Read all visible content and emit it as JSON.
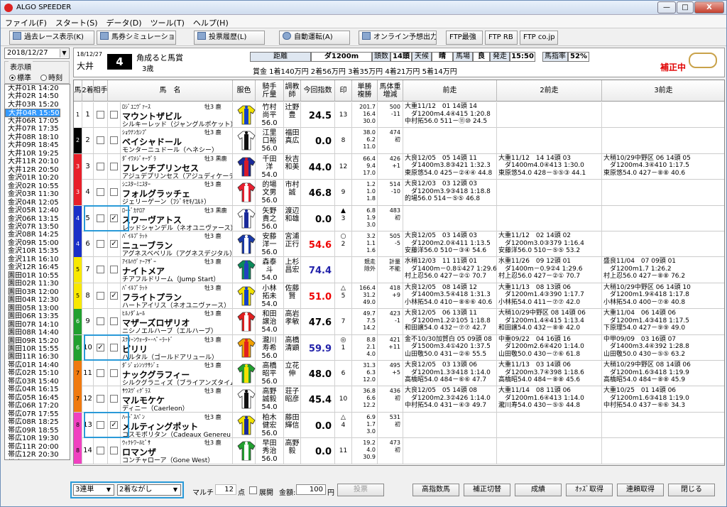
{
  "window": {
    "title": "ALGO SPEEDER",
    "min": "—",
    "max": "□",
    "close": "X"
  },
  "menu": [
    "ファイル(F)",
    "スタート(S)",
    "データ(D)",
    "ツール(T)",
    "ヘルプ(H)"
  ],
  "toolbar": [
    "過去レース表示(K)",
    "馬券シミュレーション(B)",
    "投票履歴(L)",
    "自動運転(A)",
    "オンライン予想出力",
    "FTP最強",
    "FTP RB",
    "FTP co.jp"
  ],
  "side": {
    "date": "2018/12/27",
    "order_label": "表示順",
    "opt1": "標準",
    "opt2": "時刻",
    "races": [
      "大井01R 14:20",
      "大井02R 14:50",
      "大井03R 15:20",
      "大井04R 15:50",
      "大井05R 16:30",
      "大井06R 17:05",
      "大井07R 17:35",
      "大井08R 18:10",
      "大井09R 18:45",
      "大井10R 19:25",
      "大井11R 20:10",
      "大井12R 20:50",
      "金沢01R 10:20",
      "金沢02R 10:55",
      "金沢03R 11:30",
      "金沢04R 12:05",
      "金沢05R 12:40",
      "金沢06R 13:15",
      "金沢07R 13:50",
      "金沢08R 14:25",
      "金沢09R 15:00",
      "金沢10R 15:35",
      "金沢11R 16:10",
      "金沢12R 16:45",
      "園田01R 10:55",
      "園田02R 11:30",
      "園田03R 12:00",
      "園田04R 12:30",
      "園田05R 13:00",
      "園田06R 13:35",
      "園田07R 14:10",
      "園田08R 14:40",
      "園田09R 15:20",
      "園田10R 15:55",
      "園田11R 16:30",
      "帯広01R 14:40",
      "帯広02R 15:10",
      "帯広03R 15:40",
      "帯広04R 16:15",
      "帯広05R 16:45",
      "帯広06R 17:20",
      "帯広07R 17:55",
      "帯広08R 18:25",
      "帯広09R 18:55",
      "帯広10R 19:30",
      "帯広11R 20:00",
      "帯広12R 20:30",
      "帯広13R 21:00"
    ],
    "selected": 3
  },
  "race": {
    "date": "18/12/27",
    "venue": "大井",
    "num": "4",
    "name": "角成ると馬賞",
    "age": "3歳",
    "labels": [
      "距離",
      "頭数",
      "天候",
      "馬場",
      "発走",
      "馬指率"
    ],
    "values": [
      "ダ1200m",
      "14頭",
      "晴",
      "良",
      "15:50",
      "52%"
    ],
    "prize": "賞金 1着140万円  2着56万円  3着35万円  4着21万円  5着14万円",
    "hosei": "補正中"
  },
  "headers": [
    "馬",
    "2着",
    "相手",
    "馬　名",
    "服色",
    "騎手\n斤量",
    "調教\n師",
    "今回指数",
    "印",
    "単勝\n複勝",
    "馬体重\n増減",
    "前走",
    "2前走",
    "3前走"
  ],
  "horses": [
    {
      "waku": "1",
      "wc": "#ffffff",
      "n": "1",
      "c2": false,
      "c3": false,
      "sire": "ﾛｼﾞﾕﾆｳﾞｧｰｽ",
      "name": "マウントザビル",
      "dam": "シルキーレッド（ジャングルポケット）",
      "sex": "牡3 鹿",
      "jk": "竹村\n尚平\n56.0",
      "tr": "辻野\n豊",
      "idx": "24.5",
      "ic": "#000",
      "mk": "\n13",
      "od": "201.7\n16.4\n30.0",
      "pw": "500\n-11",
      "p1": "大重11/12　01 14頭 14\n　ダ1200m4.4④415 1:20.8\n中村拓56.0 511－⑪⑩ 24.5",
      "p2": "",
      "p3": "",
      "silk": [
        "#f2e200",
        "#1540c8"
      ]
    },
    {
      "waku": "2",
      "wc": "#000000",
      "n": "2",
      "c2": false,
      "c3": false,
      "sire": "ｼｮｳﾅﾝｶﾝﾌﾟ",
      "name": "ベイシャドール",
      "dam": "モンターニュドール（ヘネシー）",
      "sex": "牡3 鹿",
      "jk": "江里\n口裕\n56.0",
      "tr": "福田\n真広",
      "idx": "0.0",
      "ic": "#000",
      "mk": "\n8",
      "od": "38.0\n6.2\n11.0",
      "pw": "474\n初",
      "p1": "",
      "p2": "",
      "p3": "",
      "silk": [
        "#ffffff",
        "#111111"
      ]
    },
    {
      "waku": "3",
      "wc": "#e8202a",
      "n": "3",
      "c2": false,
      "c3": false,
      "sire": "ﾀﾞｲﾜﾒｼﾞｬｰｸﾞﾗ",
      "name": "フレンチプリンセス",
      "dam": "アジュデプリンセス（アジュディケーティ",
      "sex": "牡3 黒鹿",
      "jk": "千田\n洋\n54.0",
      "tr": "秋吉\n和美",
      "idx": "44.0",
      "ic": "#000",
      "mk": "\n12",
      "od": "66.4\n9.4\n17.0",
      "pw": "426\n+1",
      "p1": "大良12/05　05 14頭 11\n　ダ1400m3.8③421 1:32.3\n東原悠54.0 425－②④④ 44.8",
      "p2": "大重11/12　14 14頭 03\n　ダ1400m4.0④413 1:30.0\n東原悠54.0 428－⑤⑤③ 44.1",
      "p3": "大稍10/29中野区 06 14頭 05\n　ダ1200m4.3④410 1:17.5\n東原悠54.0 427－⑧⑧ 40.6",
      "silk": [
        "#1a2a9a",
        "#d81a2a"
      ]
    },
    {
      "waku": "3",
      "wc": "#e8202a",
      "n": "4",
      "c2": false,
      "c3": false,
      "sire": "ｼﾆｽﾀｰﾐﾆｽﾀｰ",
      "name": "フォルグラッチェ",
      "dam": "ジェリーゲーン（ﾌｼﾞｷｾｷ/ｺﾙﾄ）",
      "sex": "牡3 鹿",
      "jk": "的場\n文男\n56.0",
      "tr": "市村\n誠",
      "idx": "46.8",
      "ic": "#000",
      "mk": "\n9",
      "od": "1.2\n1.0\n1.8",
      "pw": "514\n-10",
      "p1": "大良12/03　03 12頭 03\n　ダ1200m3.9③418 1:18.8\n的場56.0 514－⑤⑤ 46.8",
      "p2": "",
      "p3": "",
      "silk": [
        "#e82030",
        "#ffffff"
      ]
    },
    {
      "waku": "4",
      "wc": "#1a30c8",
      "n": "5",
      "c2": true,
      "c3": true,
      "v2": "",
      "v3": "✓",
      "sire": "ﾛｰﾄﾞｶﾅﾛｱ",
      "name": "スワーヴアトス",
      "dam": "レッドシャンデル（ネオユニヴァース）",
      "sex": "牡3 黒鹿",
      "jk": "矢野\n貴之\n56.0",
      "tr": "渡辺\n和雄",
      "idx": "0.0",
      "ic": "#000",
      "mk": "▲\n3",
      "od": "6.8\n1.9\n3.0",
      "pw": "483\n初",
      "p1": "",
      "p2": "",
      "p3": "",
      "silk": [
        "#ffffff",
        "#1a2a9a"
      ]
    },
    {
      "waku": "4",
      "wc": "#1a30c8",
      "n": "6",
      "c2": false,
      "c3": true,
      "v3": "✓",
      "sire": "ﾊﾟｲﾙﾌﾟﾗｯﾄ",
      "name": "ニューブラン",
      "dam": "アグネスベベリル（アグネスデジタル）",
      "sex": "牡3 鹿",
      "jk": "安藤\n洋一\n56.0",
      "tr": "宮浦\n正行",
      "idx": "54.6",
      "ic": "#e00",
      "mk": "○\n2",
      "od": "3.2\n1.1\n1.6",
      "pw": "505\n-5",
      "p1": "大良12/05　03 14頭 03\n　ダ1200m2.0④411 1:13.5\n安藤洋56.0 510－③④ 54.6",
      "p2": "大重11/12　02 14頭 02\n　ダ1200m3.0③379 1:16.4\n安藤洋56.0 510－⑤⑤ 53.2",
      "p3": "",
      "silk": [
        "#1a3aa8",
        "#ffffff"
      ]
    },
    {
      "waku": "5",
      "wc": "#f8e800",
      "n": "7",
      "c2": false,
      "c3": false,
      "sire": "ｱｲﾙﾊｳﾞｧｰｱｻﾞｰ",
      "name": "ナイトメア",
      "dam": "チアフルドリーム（Jump Start）",
      "sex": "牡3 鹿",
      "jk": "森泰\n斗\n54.0",
      "tr": "上杉\n昌宏",
      "idx": "74.4",
      "ic": "#22a",
      "mk": "",
      "od": "競走\n除外",
      "pw": "計量\n不能",
      "p1": "水稍12/03　11 11頭 01\n　ダ1400m－0.8①427 1:29.6\n村上忍56.0 427－②① 70.7",
      "p2": "水重11/26　09 12頭 01\n　ダ1400m－0.9②4 1:29.6\n村上忍56.0 427－②① 70.7",
      "p3": "盛良11/04　07 09頭 01\n　ダ1200m1.7 1:26.2\n村上忍56.0 427－⑧⑧ 76.2",
      "silk": [
        "#0a8a5a",
        "#2040c0"
      ]
    },
    {
      "waku": "5",
      "wc": "#f8e800",
      "n": "8",
      "c2": false,
      "c3": true,
      "v3": "✓",
      "sire": "ﾊﾟｲﾙﾌﾟﾗｯﾄ",
      "name": "フライトプラン",
      "dam": "ハートアイリス（ネオユニヴァース）",
      "sex": "牡3 鹿",
      "jk": "小林\n拓未\n54.0",
      "tr": "佐藤\n賢",
      "idx": "51.0",
      "ic": "#e00",
      "mk": "△\n5",
      "od": "166.4\n31.2\n49.0",
      "pw": "418\n+9",
      "p1": "大良12/05　08 14頭 12\n　ダ1400m3.5④418 1:31.3\n小林拓54.0 410－⑧⑥⑥ 40.6",
      "p2": "大重11/13　08 13頭 06\n　ダ1200m1.4③390 1:17.7\n小林拓54.0 411－⑦⑦ 42.0",
      "p3": "大稍10/29中野区 06 14頭 10\n　ダ1200m1.9④418 1:17.8\n小林拓54.0 400－⑦⑧ 40.8",
      "silk": [
        "#f2e200",
        "#1540c8"
      ]
    },
    {
      "waku": "6",
      "wc": "#22a030",
      "n": "9",
      "c2": false,
      "c3": false,
      "sire": "ﾋﾙﾉﾀﾞﾑｰﾙ",
      "name": "マザーズロザリオ",
      "dam": "ニシノエルハーブ（エルハーブ）",
      "sex": "牡3 鹿",
      "jk": "和田\n譲治\n54.0",
      "tr": "高岩\n孝敏",
      "idx": "47.6",
      "ic": "#000",
      "mk": "\n7",
      "od": "49.7\n7.5\n14.2",
      "pw": "423\n-1",
      "p1": "大良12/05　06 13頭 11\n　ダ1200m1.2②105 1:18.8\n和田譲54.0 432－⑦⑦ 42.7",
      "p2": "大稍10/29中野区 08 14頭 06\n　ダ1200m1.4④415 1:13.4\n和田譲54.0 432－⑧⑧ 42.0",
      "p3": "大重11/04　06 14頭 06\n　ダ1200m1.4③418 1:17.5\n下原理54.0 427－⑨⑨ 49.0",
      "silk": [
        "#e02020",
        "#ffffff"
      ]
    },
    {
      "waku": "6",
      "wc": "#22a030",
      "n": "10",
      "c2": true,
      "c3": false,
      "v2": "✓",
      "sire": "ｽｸﾘｰﾝｳｫｰﾀｰ･ﾍﾟｰﾗｰﾄﾞ",
      "name": "ピリリ",
      "dam": "ハルタル（ゴールドアリュール）",
      "sex": "牡3 鹿",
      "jk": "瀧川\n寿希\n56.0",
      "tr": "高橋\n清顕",
      "idx": "59.9",
      "ic": "#22a",
      "mk": "◎\n1",
      "od": "8.8\n2.1\n4.0",
      "pw": "421\n+11",
      "p1": "金不10/30加賀白 05 09頭 08\n　ダ1500m3.4①420 1:37.5\n山田敬50.0 431－②⑥ 55.5",
      "p2": "中重09/22　04 16頭 16\n　ダ1200m2.6④420 1:14.0\n山田敬50.0 430－⑦⑥ 61.8",
      "p3": "中甲09/09　03 16頭 07\n　ダ1400m3.4④392 1:28.8\n山田敬50.0 430－⑤⑤ 63.2",
      "silk": [
        "#f0a000",
        "#e02020"
      ]
    },
    {
      "waku": "7",
      "wc": "#f07a10",
      "n": "11",
      "c2": false,
      "c3": false,
      "sire": "ﾀﾞｼﾞｮｼﾝｿｸｻｼﾞｪ",
      "name": "ナックグラフィー",
      "dam": "シルクグラニィズ（ブライアンズタイム）",
      "sex": "牡3 鹿",
      "jk": "高橋\n昭平\n56.0",
      "tr": "立花\n伸",
      "idx": "48.0",
      "ic": "#000",
      "mk": "\n6",
      "od": "31.3\n6.3\n12.0",
      "pw": "495\n+5",
      "p1": "大良12/05　03 13頭 06\n　ダ1200m1.3③418 1:14.0\n高橋昭54.0 484－⑥⑥ 47.7",
      "p2": "大重11/13　03 14頭 06\n　ダ1200m3.7④398 1:18.6\n高橋昭54.0 484－⑧⑧ 45.6",
      "p3": "大稍10/29中野区 08 14頭 06\n　ダ1200m1.6③418 1:19.9\n高橋昭54.0 484－⑧⑧ 45.9",
      "silk": [
        "#22a030",
        "#f2e200"
      ]
    },
    {
      "waku": "7",
      "wc": "#f07a10",
      "n": "12",
      "c2": false,
      "c3": false,
      "sire": "ｻｳｽｳﾞｨｸﾞﾗｽ",
      "name": "マルモケケ",
      "dam": "ディニー（Caerleon）",
      "sex": "牡3 鹿",
      "jk": "高野\n誠毅\n54.0",
      "tr": "荘子\n昭彦",
      "idx": "45.4",
      "ic": "#000",
      "mk": "\n10",
      "od": "36.8\n6.6\n12.2",
      "pw": "436\n初",
      "p1": "大良12/05　05 14頭 08\n　ダ1200m2.3②426 1:14.0\n中村拓54.0 431－④③ 49.7",
      "p2": "大重11/14　08 11頭 06\n　ダ1200m1.6④413 1:14.0\n瀧川寿54.0 430－⑤⑤ 44.8",
      "p3": "大重10/25　01 14頭 06\n　ダ1200m1.6③418 1:19.0\n中村拓54.0 437－⑥⑥ 34.3",
      "silk": [
        "#ffffff",
        "#111111"
      ]
    },
    {
      "waku": "8",
      "wc": "#f040c0",
      "n": "13",
      "c2": false,
      "c3": true,
      "v3": "✓",
      "sire": "ﾊｰﾄﾞｽﾊﾟﾝ",
      "name": "メルティングポット",
      "dam": "コスモポリタン（Cadeaux Genereu",
      "sex": "牡3 鹿",
      "jk": "柏木\n健宏\n56.0",
      "tr": "藤田\n輝信",
      "idx": "0.0",
      "ic": "#000",
      "mk": "△\n4",
      "od": "6.9\n1.7\n3.0",
      "pw": "531\n初",
      "p1": "",
      "p2": "",
      "p3": "",
      "silk": [
        "#f2e200",
        "#1a2a9a"
      ]
    },
    {
      "waku": "8",
      "wc": "#f040c0",
      "n": "14",
      "c2": false,
      "c3": false,
      "sire": "ｳｨｸﾄﾜｰﾙﾋﾟｻ",
      "name": "ロマンザ",
      "dam": "コンチャローア（Gone West）",
      "sex": "牡3 鹿",
      "jk": "早田\n秀治\n56.0",
      "tr": "高野\n毅",
      "idx": "0.0",
      "ic": "#000",
      "mk": "\n11",
      "od": "19.2\n4.0\n30.9",
      "pw": "473\n初",
      "p1": "",
      "p2": "",
      "p3": "",
      "silk": [
        "#22a030",
        "#ffffff"
      ]
    }
  ],
  "bottom": {
    "bet": "3連単",
    "mode": "2着ながし",
    "multi": "マルチ",
    "points": "12",
    "pts_unit": "点",
    "expand": "展開",
    "amt_label": "金額:",
    "amount": "100",
    "yen": "円",
    "vote": "投票",
    "btns": [
      "高指数馬",
      "補正切替",
      "成績",
      "ｵｯｽﾞ取得",
      "連頼取得",
      "閉じる"
    ]
  }
}
